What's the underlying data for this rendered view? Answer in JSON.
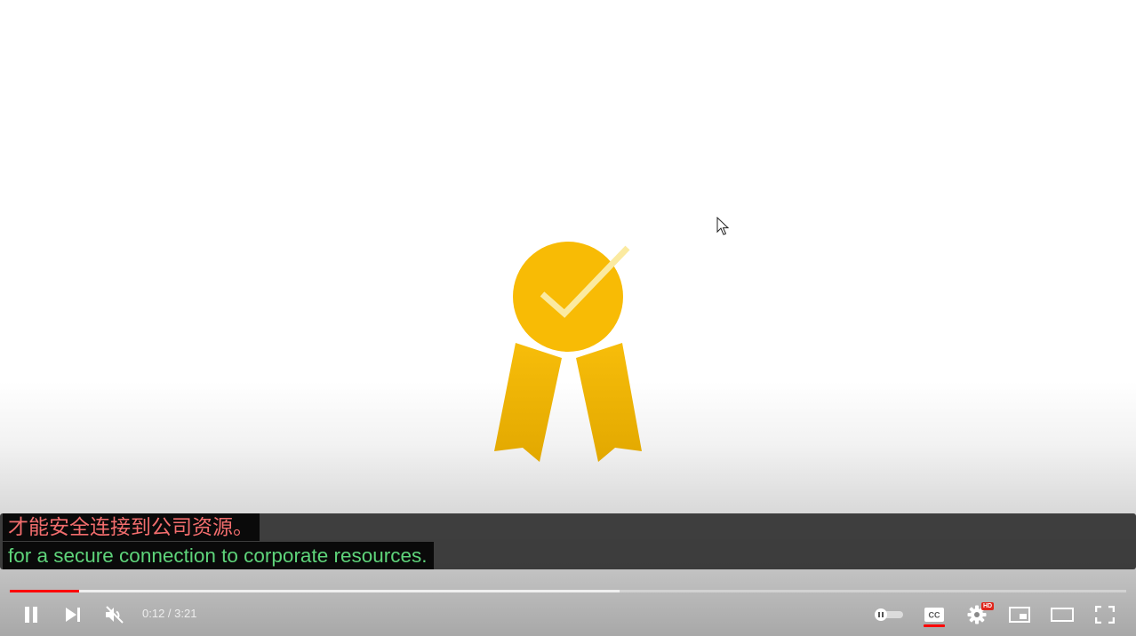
{
  "player": {
    "captions": {
      "line1": "才能安全连接到公司资源。",
      "line2": "for a secure connection to corporate resources.",
      "line1_color": "#f26d6d",
      "line2_color": "#5ed47a"
    },
    "progress": {
      "played_fraction": 0.062,
      "buffered_fraction": 0.546,
      "played_color": "#ff0000"
    },
    "time": {
      "display": "0:12 / 3:21"
    },
    "controls": {
      "left": [
        "pause-icon",
        "next-icon",
        "mute-icon"
      ],
      "right": [
        "autoplay-toggle-icon",
        "captions-icon",
        "settings-icon",
        "miniplayer-icon",
        "theater-mode-icon",
        "fullscreen-icon"
      ]
    },
    "settings_badge": "HD",
    "artwork": {
      "icon": "award-ribbon-icon",
      "medal_color": "#f5b800",
      "check_color": "#fbeaa0"
    }
  }
}
